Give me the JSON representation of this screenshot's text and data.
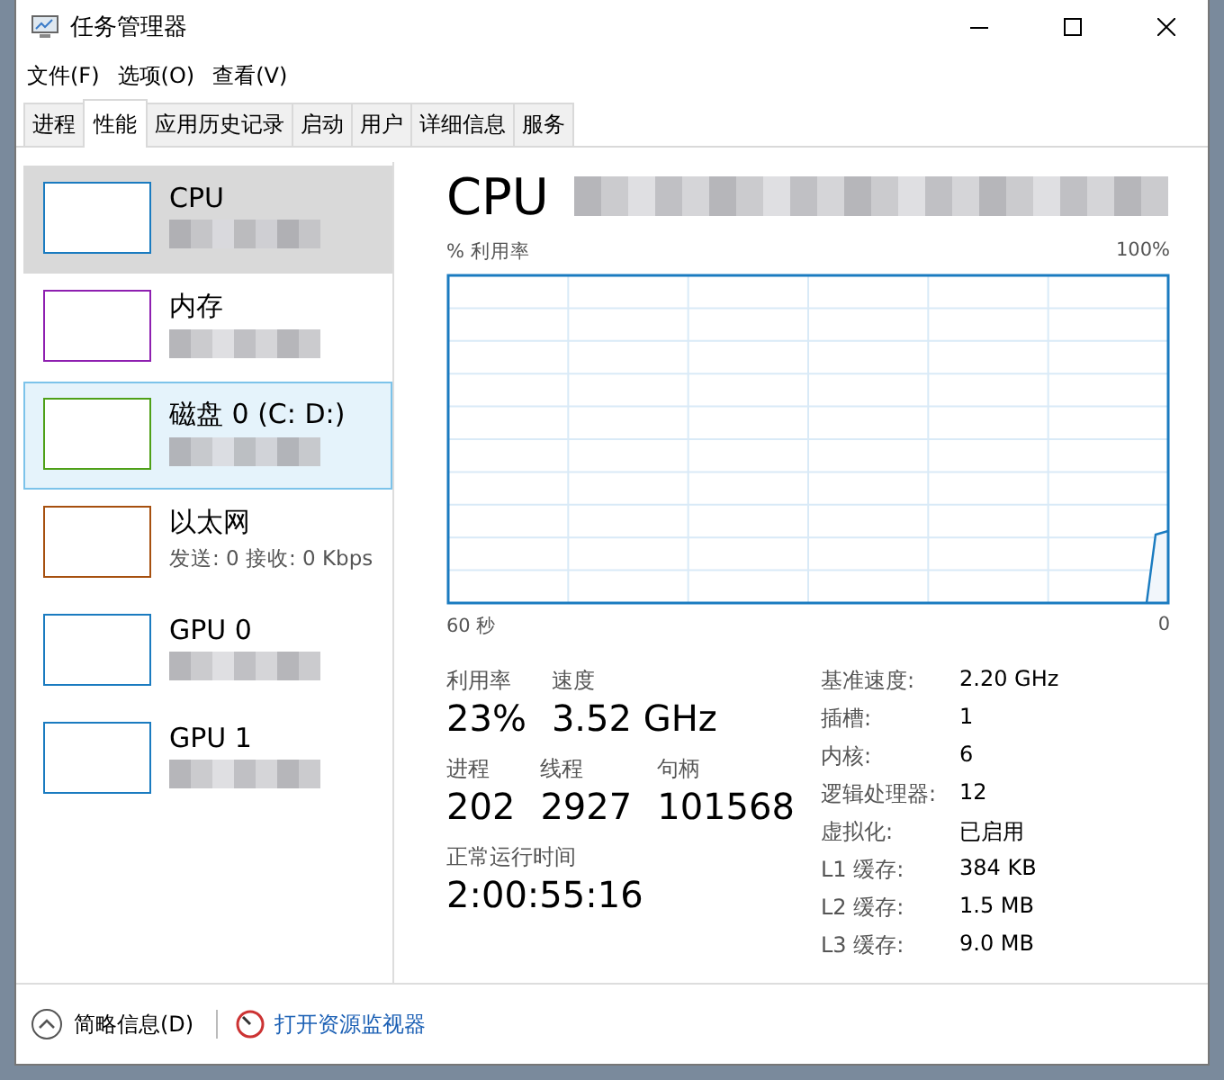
{
  "window": {
    "title": "任务管理器"
  },
  "menu": [
    "文件(F)",
    "选项(O)",
    "查看(V)"
  ],
  "tabs": [
    {
      "label": "进程",
      "selected": false
    },
    {
      "label": "性能",
      "selected": true
    },
    {
      "label": "应用历史记录",
      "selected": false
    },
    {
      "label": "启动",
      "selected": false
    },
    {
      "label": "用户",
      "selected": false
    },
    {
      "label": "详细信息",
      "selected": false
    },
    {
      "label": "服务",
      "selected": false
    }
  ],
  "sidebar": {
    "items": [
      {
        "name": "CPU",
        "color": "#1a7bc0",
        "selected": true,
        "hovered": false
      },
      {
        "name": "内存",
        "color": "#8e1fb0",
        "selected": false,
        "hovered": false
      },
      {
        "name": "磁盘 0 (C: D:)",
        "color": "#4ea017",
        "selected": false,
        "hovered": true
      },
      {
        "name": "以太网",
        "detail": "发送: 0 接收: 0 Kbps",
        "color": "#a6500f",
        "selected": false,
        "hovered": false
      },
      {
        "name": "GPU 0",
        "color": "#1a7bc0",
        "selected": false,
        "hovered": false
      },
      {
        "name": "GPU 1",
        "color": "#1a7bc0",
        "selected": false,
        "hovered": false
      }
    ]
  },
  "detail": {
    "title": "CPU",
    "graph": {
      "ylabel": "% 利用率",
      "ymax_label": "100%",
      "xstart_label": "60 秒",
      "xend_label": "0"
    },
    "stats": [
      [
        {
          "label": "利用率",
          "value": "23%"
        },
        {
          "label": "速度",
          "value": "3.52 GHz"
        }
      ],
      [
        {
          "label": "进程",
          "value": "202"
        },
        {
          "label": "线程",
          "value": "2927"
        },
        {
          "label": "句柄",
          "value": "101568"
        }
      ],
      [
        {
          "label": "正常运行时间",
          "value": "2:00:55:16"
        }
      ]
    ],
    "specs": [
      {
        "label": "基准速度:",
        "value": "2.20 GHz"
      },
      {
        "label": "插槽:",
        "value": "1"
      },
      {
        "label": "内核:",
        "value": "6"
      },
      {
        "label": "逻辑处理器:",
        "value": "12"
      },
      {
        "label": "虚拟化:",
        "value": "已启用"
      },
      {
        "label": "L1 缓存:",
        "value": "384 KB"
      },
      {
        "label": "L2 缓存:",
        "value": "1.5 MB"
      },
      {
        "label": "L3 缓存:",
        "value": "9.0 MB"
      }
    ]
  },
  "footer": {
    "summary": "简略信息(D)",
    "monitor_link": "打开资源监视器"
  }
}
